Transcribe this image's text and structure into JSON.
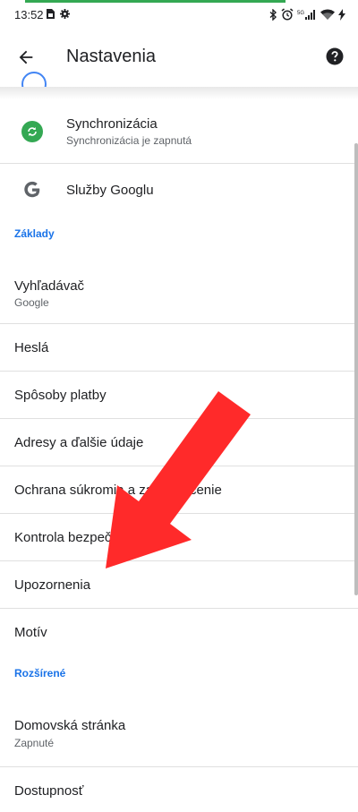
{
  "status_bar": {
    "time": "13:52",
    "network": "5G"
  },
  "app_bar": {
    "title": "Nastavenia"
  },
  "account_rows": [
    {
      "title": "Synchronizácia",
      "subtitle": "Synchronizácia je zapnutá",
      "icon": "sync-icon"
    },
    {
      "title": "Služby Googlu",
      "subtitle": "",
      "icon": "google-g-icon"
    }
  ],
  "sections": {
    "basics": "Základy",
    "advanced": "Rozšírené"
  },
  "basic_rows": [
    {
      "title": "Vyhľadávač",
      "subtitle": "Google"
    },
    {
      "title": "Heslá"
    },
    {
      "title": "Spôsoby platby"
    },
    {
      "title": "Adresy a ďalšie údaje"
    },
    {
      "title": "Ochrana súkromia a zabezpečenie"
    },
    {
      "title": "Kontrola bezpečnosti"
    },
    {
      "title": "Upozornenia"
    },
    {
      "title": "Motív"
    }
  ],
  "advanced_rows": [
    {
      "title": "Domovská stránka",
      "subtitle": "Zapnuté"
    },
    {
      "title": "Dostupnosť"
    }
  ],
  "colors": {
    "accent": "#1a73e8",
    "progress": "#34a853",
    "sync_icon_bg": "#34a853",
    "arrow": "#ff2a2a"
  }
}
